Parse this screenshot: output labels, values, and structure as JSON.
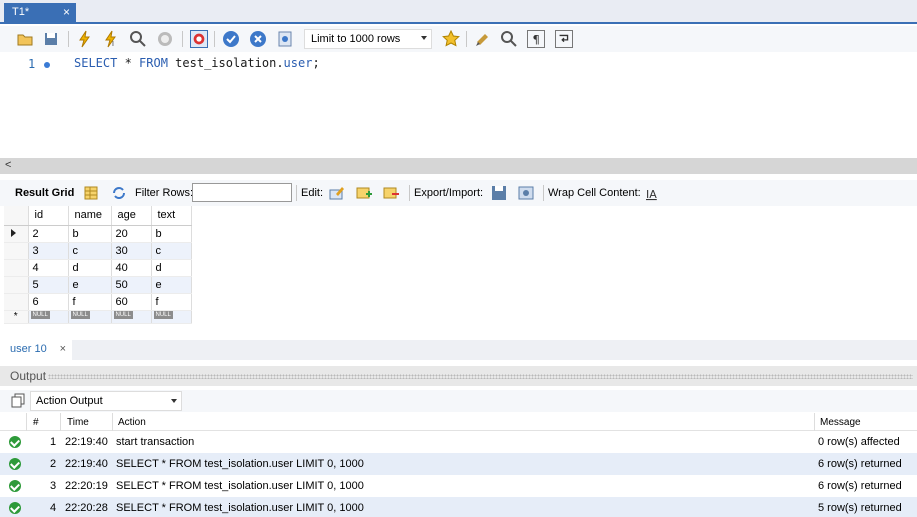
{
  "window": {
    "tab_label": "T1*",
    "tab_close": "×"
  },
  "toolbar": {
    "limit_select": "Limit to 1000 rows",
    "colors": {
      "accent": "#3a6fb5"
    }
  },
  "editor": {
    "line_number": "1",
    "sql_kw1": "SELECT",
    "sql_star": " * ",
    "sql_kw2": "FROM",
    "sql_rest": " test_isolation.",
    "sql_table": "user",
    "sql_end": ";"
  },
  "scroll": {
    "left_arrow": "<"
  },
  "result_toolbar": {
    "result_grid": "Result Grid",
    "filter_rows": "Filter Rows:",
    "edit": "Edit:",
    "export_import": "Export/Import:",
    "wrap_cell": "Wrap Cell Content:"
  },
  "grid": {
    "columns": [
      "id",
      "name",
      "age",
      "text"
    ],
    "rows": [
      [
        "2",
        "b",
        "20",
        "b"
      ],
      [
        "3",
        "c",
        "30",
        "c"
      ],
      [
        "4",
        "d",
        "40",
        "d"
      ],
      [
        "5",
        "e",
        "50",
        "e"
      ],
      [
        "6",
        "f",
        "60",
        "f"
      ]
    ],
    "null_label": "NULL",
    "new_row_marker": "*"
  },
  "result_tabs": {
    "tab1": "user 10",
    "close": "×"
  },
  "output": {
    "header": "Output",
    "selector": "Action Output",
    "columns": {
      "num": "#",
      "time": "Time",
      "action": "Action",
      "message": "Message"
    },
    "rows": [
      {
        "num": "1",
        "time": "22:19:40",
        "action": "start transaction",
        "message": "0 row(s) affected"
      },
      {
        "num": "2",
        "time": "22:19:40",
        "action": "SELECT * FROM test_isolation.user LIMIT 0, 1000",
        "message": "6 row(s) returned"
      },
      {
        "num": "3",
        "time": "22:20:19",
        "action": "SELECT * FROM test_isolation.user LIMIT 0, 1000",
        "message": "6 row(s) returned"
      },
      {
        "num": "4",
        "time": "22:20:28",
        "action": "SELECT * FROM test_isolation.user LIMIT 0, 1000",
        "message": "5 row(s) returned"
      }
    ]
  }
}
